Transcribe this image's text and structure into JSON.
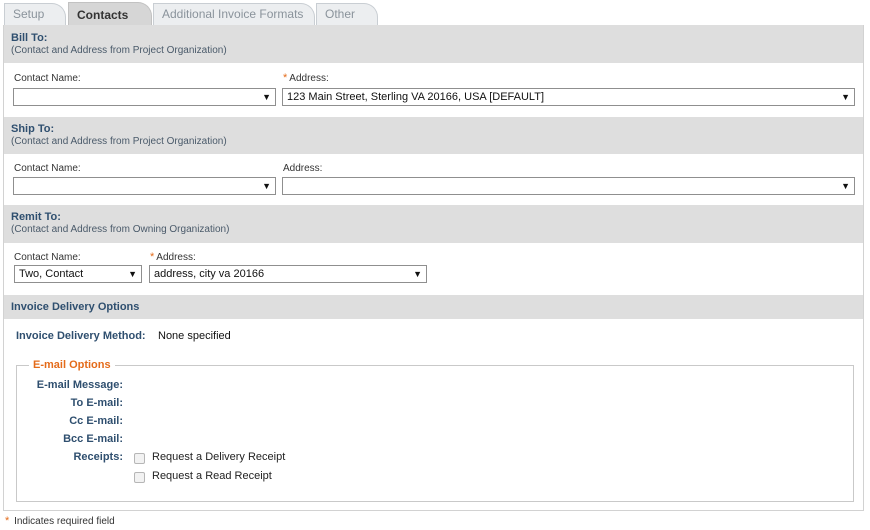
{
  "tabs": [
    {
      "label": "Setup"
    },
    {
      "label": "Contacts"
    },
    {
      "label": "Additional Invoice Formats"
    },
    {
      "label": "Other"
    }
  ],
  "bill_to": {
    "title": "Bill To:",
    "subtitle": "(Contact and Address from Project Organization)",
    "contact_label": "Contact Name:",
    "contact_value": "",
    "address_label": "Address:",
    "address_value": "123 Main Street, Sterling VA 20166, USA [DEFAULT]"
  },
  "ship_to": {
    "title": "Ship To:",
    "subtitle": "(Contact and Address from Project Organization)",
    "contact_label": "Contact Name:",
    "contact_value": "",
    "address_label": "Address:",
    "address_value": ""
  },
  "remit_to": {
    "title": "Remit To:",
    "subtitle": "(Contact and Address from Owning Organization)",
    "contact_label": "Contact Name:",
    "contact_value": "Two, Contact",
    "address_label": "Address:",
    "address_value": "address, city va 20166"
  },
  "delivery": {
    "title": "Invoice Delivery Options",
    "method_label": "Invoice Delivery Method:",
    "method_value": "None specified"
  },
  "email_options": {
    "legend": "E-mail Options",
    "message_label": "E-mail Message:",
    "to_label": "To E-mail:",
    "cc_label": "Cc E-mail:",
    "bcc_label": "Bcc E-mail:",
    "receipts_label": "Receipts:",
    "delivery_receipt_label": "Request a Delivery Receipt",
    "read_receipt_label": "Request a Read Receipt"
  },
  "required_marker": "*",
  "footnote": "Indicates required field",
  "colors": {
    "section_bg": "#dedede",
    "heading": "#2f4f6f",
    "accent_orange": "#e46b1a"
  }
}
